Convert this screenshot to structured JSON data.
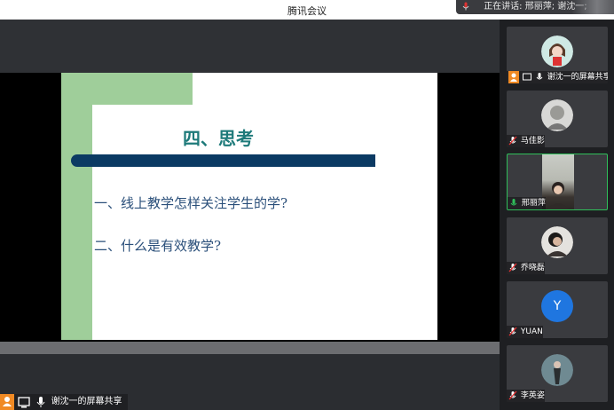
{
  "window": {
    "title": "腾讯会议"
  },
  "speaking": {
    "text": "正在讲话: 邢丽萍; 谢沈一;"
  },
  "slide": {
    "heading": "四、思考",
    "line1": "一、线上教学怎样关注学生的学?",
    "line2": "二、什么是有效教学?"
  },
  "share_badge": {
    "label": "谢沈一的屏幕共享"
  },
  "participants": [
    {
      "name": "谢沈一的屏幕共享",
      "avatar": "cartoon-girl-avatar",
      "muted": false,
      "active": false
    },
    {
      "name": "马佳影",
      "avatar": "photo-avatar",
      "muted": true,
      "active": false
    },
    {
      "name": "邢丽萍",
      "avatar": "camera-video",
      "muted": false,
      "active": true
    },
    {
      "name": "乔晓磊",
      "avatar": "photo-avatar",
      "muted": true,
      "active": false
    },
    {
      "name": "YUAN",
      "avatar_letter": "Y",
      "muted": true,
      "active": false
    },
    {
      "name": "李英姿",
      "avatar": "photo-avatar",
      "muted": true,
      "active": false
    }
  ],
  "colors": {
    "accent_green": "#2fbf5a",
    "share_orange": "#f08a24",
    "slide_teal": "#1e7a7a",
    "slide_navy": "#0b3a63"
  }
}
